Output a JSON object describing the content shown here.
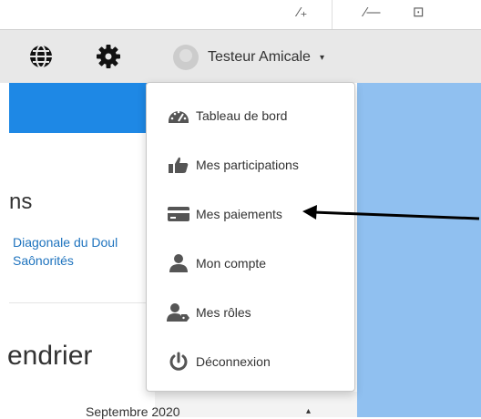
{
  "browser_toolbar": {
    "items": [
      {
        "name": "collections-icon",
        "glyph": "⁄₊"
      },
      {
        "name": "favorites-list-icon",
        "glyph": "⁄—"
      },
      {
        "name": "share-icon",
        "glyph": "⊡"
      }
    ]
  },
  "navbar": {
    "icons": [
      {
        "name": "globe-icon"
      },
      {
        "name": "gear-icon"
      }
    ],
    "user": {
      "name": "Testeur Amicale",
      "caret": "▾"
    }
  },
  "dropdown": {
    "items": [
      {
        "label": "Tableau de bord",
        "icon": "dashboard-icon"
      },
      {
        "label": "Mes participations",
        "icon": "thumbs-up-icon"
      },
      {
        "label": "Mes paiements",
        "icon": "credit-card-icon"
      },
      {
        "label": "Mon compte",
        "icon": "user-icon"
      },
      {
        "label": "Mes rôles",
        "icon": "user-tag-icon"
      },
      {
        "label": "Déconnexion",
        "icon": "power-icon"
      }
    ]
  },
  "background": {
    "heading_1": "ns",
    "link_1": "Diagonale du Doul",
    "link_2": "Saônorités",
    "heading_2": "endrier",
    "month_label": "Septembre 2020",
    "month_caret": "▴"
  },
  "colors": {
    "navbar_bg": "#e8e8e8",
    "primary_blue": "#1e88e5",
    "light_blue": "#90c0f0",
    "link_blue": "#1e73be",
    "text": "#333333"
  }
}
